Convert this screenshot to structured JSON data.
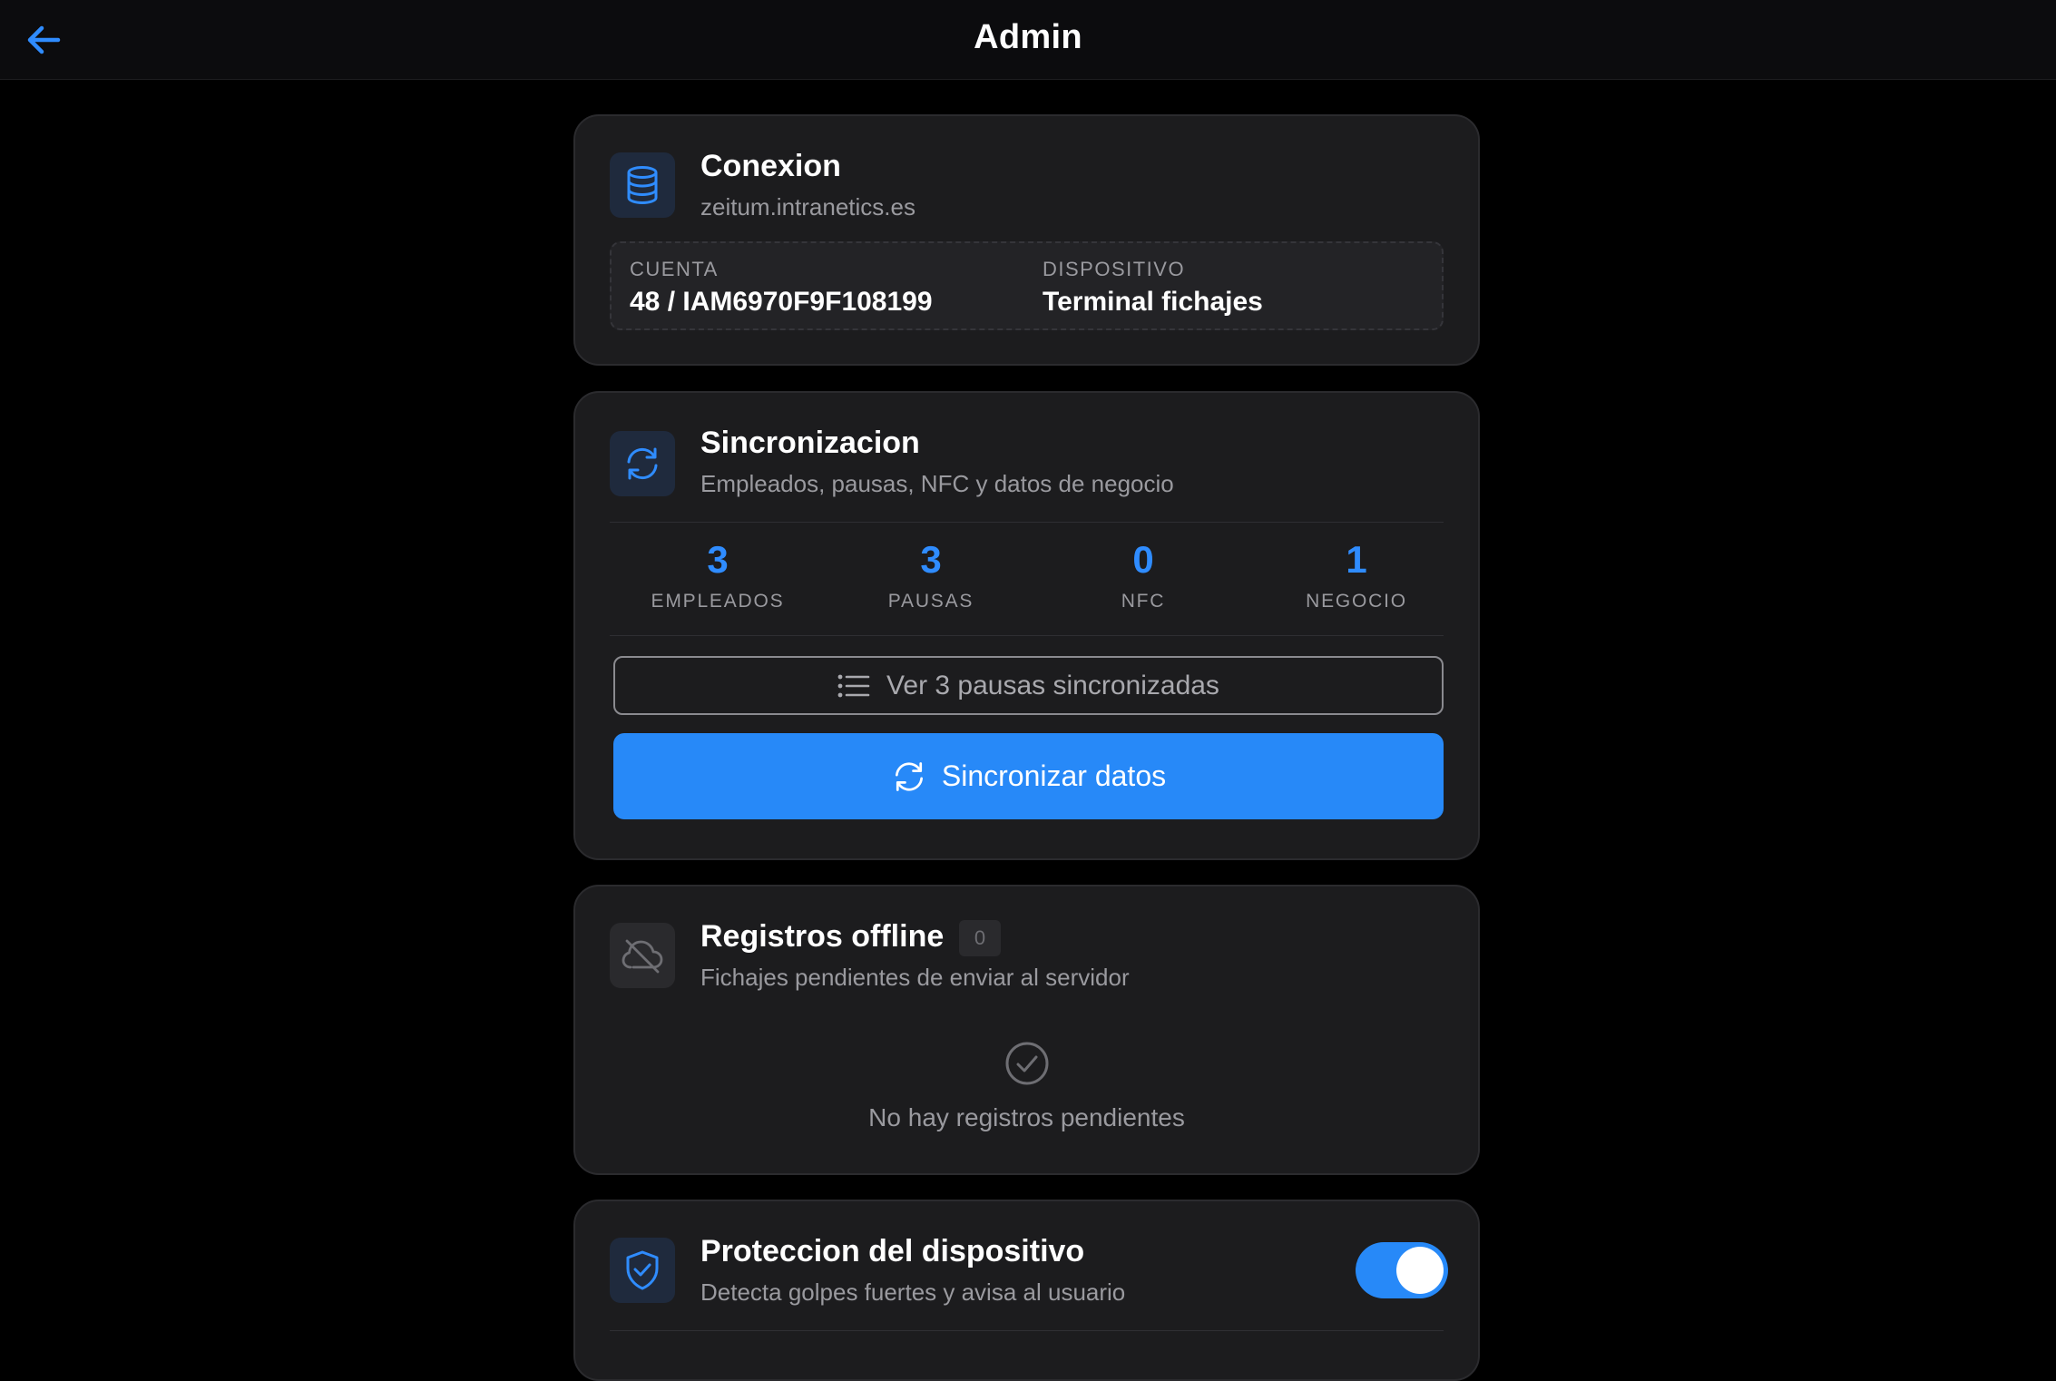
{
  "header": {
    "title": "Admin",
    "back_icon": "arrow-left-icon"
  },
  "connection": {
    "title": "Conexion",
    "host": "zeitum.intranetics.es",
    "icon": "database-icon",
    "account_label": "CUENTA",
    "account_value": "48 / IAM6970F9F108199",
    "device_label": "DISPOSITIVO",
    "device_value": "Terminal fichajes"
  },
  "sync": {
    "title": "Sincronizacion",
    "subtitle": "Empleados, pausas, NFC y datos de negocio",
    "icon": "sync-icon",
    "stats": [
      {
        "value": "3",
        "label": "EMPLEADOS"
      },
      {
        "value": "3",
        "label": "PAUSAS"
      },
      {
        "value": "0",
        "label": "NFC"
      },
      {
        "value": "1",
        "label": "NEGOCIO"
      }
    ],
    "view_pauses_label": "Ver 3 pausas sincronizadas",
    "sync_button_label": "Sincronizar datos"
  },
  "offline": {
    "title": "Registros offline",
    "count": "0",
    "subtitle": "Fichajes pendientes de enviar al servidor",
    "icon": "cloud-off-icon",
    "empty_message": "No hay registros pendientes"
  },
  "protection": {
    "title": "Proteccion del dispositivo",
    "subtitle": "Detecta golpes fuertes y avisa al usuario",
    "icon": "shield-check-icon",
    "enabled": true
  },
  "colors": {
    "accent": "#2789f8",
    "background": "#000000",
    "card": "#1c1c1e"
  }
}
